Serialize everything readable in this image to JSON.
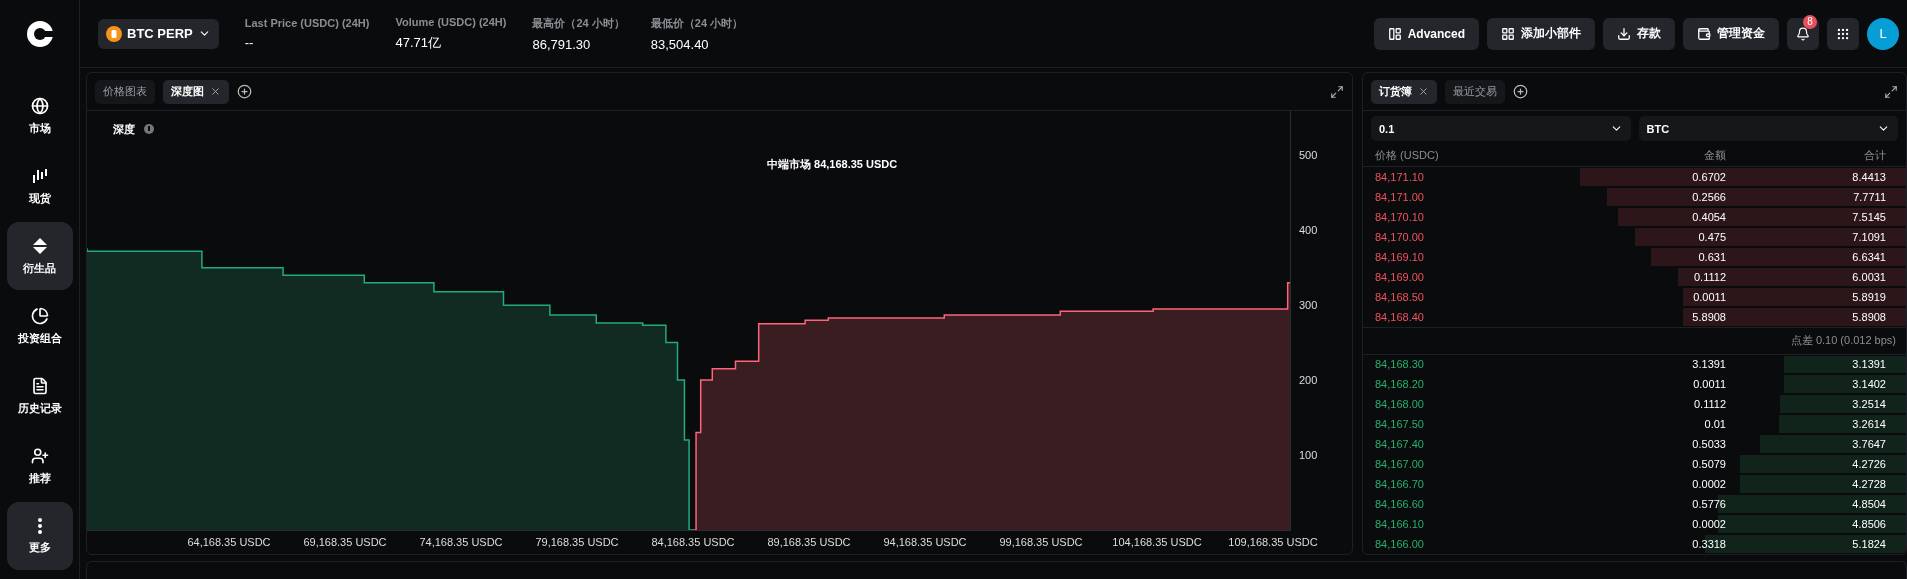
{
  "sidebar": {
    "items": [
      {
        "label": "市场",
        "kind": "market",
        "selected": false
      },
      {
        "label": "现货",
        "kind": "spot",
        "selected": false
      },
      {
        "label": "衍生品",
        "kind": "derivatives",
        "selected": true
      },
      {
        "label": "投资组合",
        "kind": "portfolio",
        "selected": false
      },
      {
        "label": "历史记录",
        "kind": "history",
        "selected": false
      },
      {
        "label": "推荐",
        "kind": "referral",
        "selected": false
      },
      {
        "label": "更多",
        "kind": "more",
        "selected": true
      }
    ]
  },
  "top_bar": {
    "market": "BTC PERP",
    "stats": [
      {
        "label": "Last Price (USDC) (24H)",
        "value": "--"
      },
      {
        "label": "Volume (USDC) (24H)",
        "value": "47.71亿"
      },
      {
        "label": "最高价（24 小时）",
        "value": "86,791.30"
      },
      {
        "label": "最低价（24 小时）",
        "value": "83,504.40"
      }
    ],
    "buttons": [
      {
        "label": "Advanced",
        "kind": "advanced"
      },
      {
        "label": "添加小部件",
        "kind": "widget"
      },
      {
        "label": "存款",
        "kind": "deposit"
      },
      {
        "label": "管理资金",
        "kind": "funds"
      }
    ],
    "notifications": "8",
    "avatar": "L"
  },
  "chart_panel": {
    "tabs": [
      {
        "label": "价格图表",
        "selected": false,
        "closable": false
      },
      {
        "label": "深度图",
        "selected": true,
        "closable": true
      }
    ],
    "depth_label": "深度",
    "mid_market": "中端市场 84,168.35 USDC",
    "chart_data": {
      "type": "area",
      "xlim": [
        58048,
        109944
      ],
      "ylim": [
        0,
        559
      ],
      "xticks": [
        {
          "value": 64168.35,
          "label": "64,168.35 USDC"
        },
        {
          "value": 69168.35,
          "label": "69,168.35 USDC"
        },
        {
          "value": 74168.35,
          "label": "74,168.35 USDC"
        },
        {
          "value": 79168.35,
          "label": "79,168.35 USDC"
        },
        {
          "value": 84168.35,
          "label": "84,168.35 USDC"
        },
        {
          "value": 89168.35,
          "label": "89,168.35 USDC"
        },
        {
          "value": 94168.35,
          "label": "94,168.35 USDC"
        },
        {
          "value": 99168.35,
          "label": "99,168.35 USDC"
        },
        {
          "value": 104168.35,
          "label": "104,168.35 USDC"
        },
        {
          "value": 109168.35,
          "label": "109,168.35 USDC"
        }
      ],
      "yticks": [
        100,
        200,
        300,
        400,
        500
      ],
      "series": [
        {
          "color": "#112a22",
          "x": [
            58048,
            63000,
            66500,
            70000,
            73000,
            76000,
            78000,
            80000,
            82000,
            83000,
            83500,
            83800,
            84000,
            84168.35
          ],
          "values": [
            376,
            372,
            350,
            340,
            330,
            318,
            300,
            287,
            276,
            273,
            250,
            200,
            120,
            0
          ]
        },
        {
          "color": "#3a1d21",
          "x": [
            84168.35,
            84300,
            84500,
            85000,
            86000,
            87000,
            89000,
            90000,
            95000,
            100000,
            104000,
            109500,
            109800,
            109944
          ],
          "values": [
            0,
            130,
            200,
            215,
            225,
            275,
            280,
            283,
            287,
            292,
            295,
            295,
            330,
            330
          ]
        }
      ]
    }
  },
  "order_book": {
    "tabs": [
      {
        "label": "订货簿",
        "selected": true,
        "closable": true
      },
      {
        "label": "最近交易",
        "selected": false,
        "closable": false
      }
    ],
    "increment": "0.1",
    "unit": "BTC",
    "columns": [
      "价格 (USDC)",
      "金额",
      "合计"
    ],
    "asks": [
      {
        "price": "84,171.10",
        "amount": "0.6702",
        "total": "8.4413",
        "level": 0.6
      },
      {
        "price": "84,171.00",
        "amount": "0.2566",
        "total": "7.7711",
        "level": 0.55
      },
      {
        "price": "84,170.10",
        "amount": "0.4054",
        "total": "7.5145",
        "level": 0.53
      },
      {
        "price": "84,170.00",
        "amount": "0.475",
        "total": "7.1091",
        "level": 0.5
      },
      {
        "price": "84,169.10",
        "amount": "0.631",
        "total": "6.6341",
        "level": 0.47
      },
      {
        "price": "84,169.00",
        "amount": "0.1112",
        "total": "6.0031",
        "level": 0.42
      },
      {
        "price": "84,168.50",
        "amount": "0.0011",
        "total": "5.8919",
        "level": 0.41
      },
      {
        "price": "84,168.40",
        "amount": "5.8908",
        "total": "5.8908",
        "level": 0.41
      }
    ],
    "spread": "点差 0.10 (0.012 bps)",
    "bids": [
      {
        "price": "84,168.30",
        "amount": "3.1391",
        "total": "3.1391",
        "level": 0.224
      },
      {
        "price": "84,168.20",
        "amount": "0.0011",
        "total": "3.1402",
        "level": 0.224
      },
      {
        "price": "84,168.00",
        "amount": "0.1112",
        "total": "3.2514",
        "level": 0.232
      },
      {
        "price": "84,167.50",
        "amount": "0.01",
        "total": "3.2614",
        "level": 0.233
      },
      {
        "price": "84,167.40",
        "amount": "0.5033",
        "total": "3.7647",
        "level": 0.269
      },
      {
        "price": "84,167.00",
        "amount": "0.5079",
        "total": "4.2726",
        "level": 0.305
      },
      {
        "price": "84,166.70",
        "amount": "0.0002",
        "total": "4.2728",
        "level": 0.305
      },
      {
        "price": "84,166.60",
        "amount": "0.5776",
        "total": "4.8504",
        "level": 0.346
      },
      {
        "price": "84,166.10",
        "amount": "0.0002",
        "total": "4.8506",
        "level": 0.346
      },
      {
        "price": "84,166.00",
        "amount": "0.3318",
        "total": "5.1824",
        "level": 0.37
      }
    ]
  }
}
